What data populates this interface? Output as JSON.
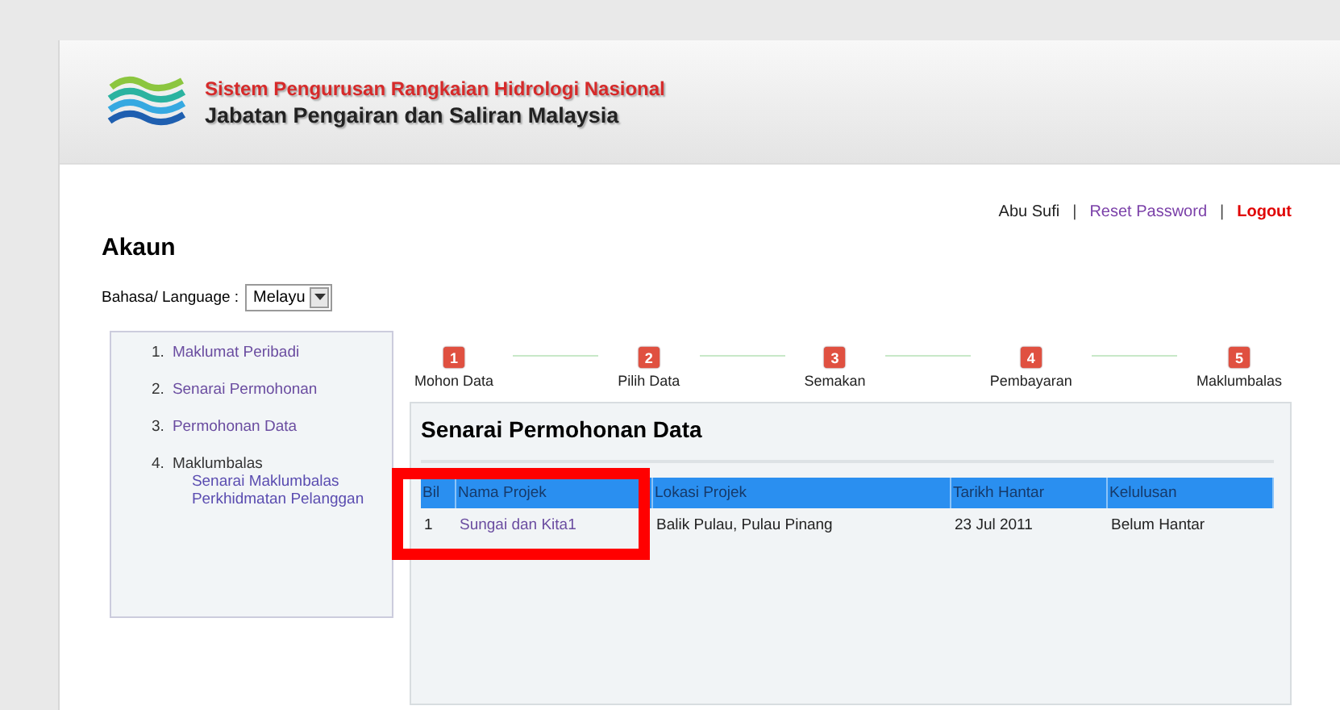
{
  "header": {
    "system_name": "Sistem Pengurusan Rangkaian Hidrologi Nasional",
    "department": "Jabatan Pengairan dan Saliran Malaysia"
  },
  "user_links": [
    {
      "kind": "text",
      "label": "Abu Sufi"
    },
    {
      "kind": "separator",
      "label": "|"
    },
    {
      "kind": "link",
      "label": "Reset Password"
    },
    {
      "kind": "separator",
      "label": "|"
    },
    {
      "kind": "logout",
      "label": "Logout"
    }
  ],
  "page_title": "Akaun",
  "language": {
    "label": "Bahasa/ Language :",
    "value": "Melayu"
  },
  "sidebar": {
    "items": [
      {
        "number": "1.",
        "label": "Maklumat Peribadi",
        "kind": "link"
      },
      {
        "number": "2.",
        "label": "Senarai Permohonan",
        "kind": "link"
      },
      {
        "number": "3.",
        "label": "Permohonan Data",
        "kind": "link"
      },
      {
        "number": "4.",
        "label": "Maklumbalas",
        "kind": "heading",
        "children": [
          {
            "label": "Senarai Maklumbalas Perkhidmatan Pelanggan"
          }
        ]
      }
    ]
  },
  "steps": [
    {
      "number": "1",
      "label": "Mohon Data"
    },
    {
      "number": "2",
      "label": "Pilih Data"
    },
    {
      "number": "3",
      "label": "Semakan"
    },
    {
      "number": "4",
      "label": "Pembayaran"
    },
    {
      "number": "5",
      "label": "Maklumbalas"
    }
  ],
  "panel": {
    "title": "Senarai Permohonan Data",
    "table": {
      "columns": [
        "Bil",
        "Nama Projek",
        "Lokasi Projek",
        "Tarikh Hantar",
        "Kelulusan"
      ],
      "rows": [
        [
          "1",
          "Sungai dan Kita1",
          "Balik Pulau, Pulau Pinang",
          "23 Jul 2011",
          "Belum Hantar"
        ]
      ]
    }
  }
}
